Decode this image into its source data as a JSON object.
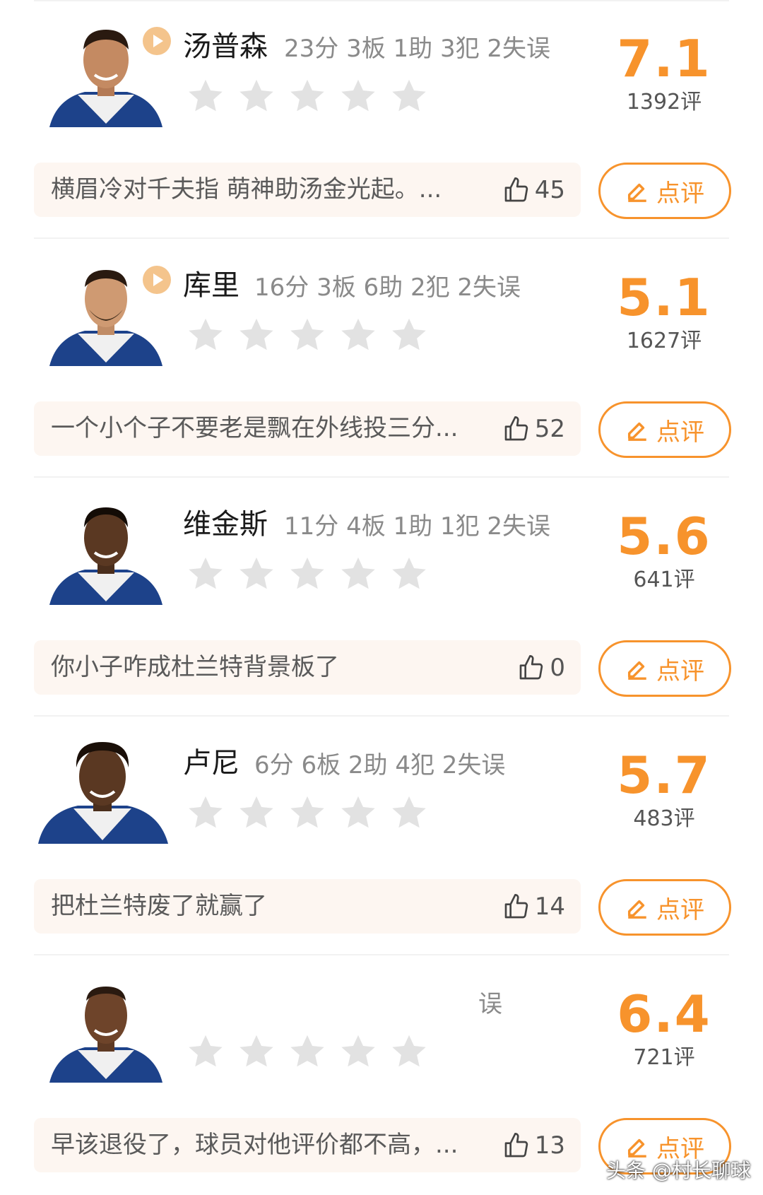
{
  "colors": {
    "accent": "#f7932c",
    "star_empty": "#e2e2e2",
    "comment_bg": "#fdf6f1"
  },
  "players": [
    {
      "name": "汤普森",
      "stats": "23分 3板 1助 3犯 2失误",
      "score": "7.1",
      "votes": "1392评",
      "rating_stars": 0,
      "has_play_icon": true,
      "comment": "横眉冷对千夫指 萌神助汤金光起。...",
      "likes": "45",
      "rate_label": "点评"
    },
    {
      "name": "库里",
      "stats": "16分 3板 6助 2犯 2失误",
      "score": "5.1",
      "votes": "1627评",
      "rating_stars": 0,
      "has_play_icon": true,
      "comment": "一个小个子不要老是飘在外线投三分...",
      "likes": "52",
      "rate_label": "点评"
    },
    {
      "name": "维金斯",
      "stats": "11分 4板 1助 1犯 2失误",
      "score": "5.6",
      "votes": "641评",
      "rating_stars": 0,
      "has_play_icon": false,
      "comment": "你小子咋成杜兰特背景板了",
      "likes": "0",
      "rate_label": "点评"
    },
    {
      "name": "卢尼",
      "stats": "6分 6板 2助 4犯 2失误",
      "score": "5.7",
      "votes": "483评",
      "rating_stars": 0,
      "has_play_icon": false,
      "comment": "把杜兰特废了就赢了",
      "likes": "14",
      "rate_label": "点评"
    },
    {
      "name": "",
      "stats": "误",
      "score": "6.4",
      "votes": "721评",
      "rating_stars": 0,
      "has_play_icon": false,
      "comment": "早该退役了，球员对他评价都不高，...",
      "likes": "13",
      "rate_label": "点评"
    }
  ],
  "watermark": "头条 @村长聊球"
}
